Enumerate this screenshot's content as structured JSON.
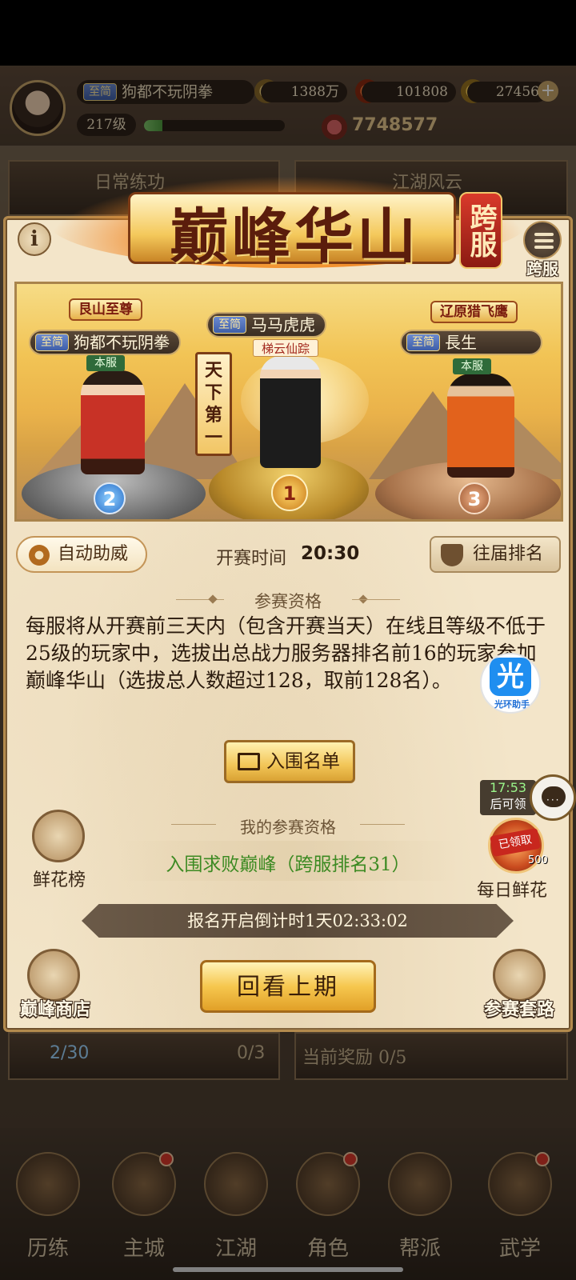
{
  "player": {
    "tag": "至简",
    "name": "狗都不玩阴拳",
    "level": "217级",
    "exp_fraction": 0.13,
    "power": "7748577"
  },
  "resources": {
    "coins": "1388万",
    "orbs": "101808",
    "gold": "27456"
  },
  "background": {
    "card_daily": "日常练功",
    "card_jianghu": "江湖风云",
    "stamina": "2/30",
    "counter": "0/3",
    "reward": "当前奖励 0/5"
  },
  "nav": [
    {
      "label": "历练"
    },
    {
      "label": "主城"
    },
    {
      "label": "江湖"
    },
    {
      "label": "角色"
    },
    {
      "label": "帮派"
    },
    {
      "label": "武学"
    }
  ],
  "modal": {
    "title": "巅峰华山",
    "seal": "跨服",
    "info_icon": "i",
    "cross_server_label": "跨服",
    "champion_banner": "天下第一",
    "podium": [
      {
        "rank": "2",
        "title": "艮山至尊",
        "tag": "至简",
        "name": "狗都不玩阴拳",
        "server": "本服"
      },
      {
        "rank": "1",
        "tag": "至简",
        "name": "马马虎虎",
        "subtitle": "梯云仙踪"
      },
      {
        "rank": "3",
        "title": "辽原猎飞鹰",
        "tag": "至简",
        "name": "長生",
        "server": "本服"
      }
    ],
    "auto_cheer": "自动助威",
    "start_label": "开赛时间",
    "start_time": "20:30",
    "past_rank": "往届排名",
    "qual_title": "参赛资格",
    "qual_text": "每服将从开赛前三天内（包含开赛当天）在线且等级不低于25级的玩家中，选拔出总战力服务器排名前16的玩家参加巅峰华山（选拔总人数超过128，取前128名）。",
    "list_button": "入围名单",
    "my_qual_title": "我的参赛资格",
    "my_qual_value": "入围求败巅峰（跨服排名31）",
    "countdown": "报名开启倒计时1天02:33:02",
    "replay_button": "回看上期",
    "flower_rank": "鲜花榜",
    "daily_flower": "每日鲜花",
    "flower_timer": "17:53",
    "flower_timer_suffix": "后可领",
    "flower_stamp": "已领取",
    "flower_count": "500",
    "shop": "巅峰商店",
    "tactics": "参赛套路",
    "guang_icon": "光",
    "guang_label": "光环助手"
  }
}
